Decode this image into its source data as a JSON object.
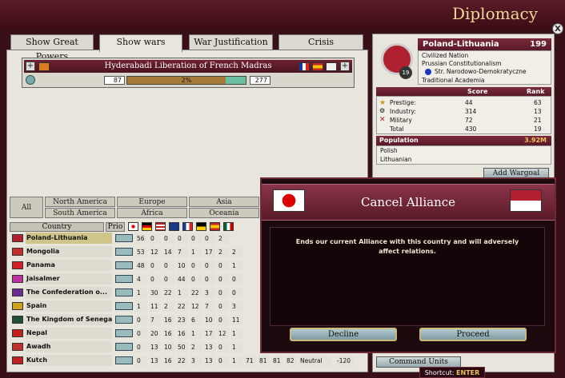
{
  "window": {
    "title": "Diplomacy",
    "close": "X"
  },
  "tabs": [
    {
      "label": "Show Great Powers"
    },
    {
      "label": "Show wars"
    },
    {
      "label": "War Justification"
    },
    {
      "label": "Crisis"
    }
  ],
  "war": {
    "name": "Hyderabadi Liberation of French Madras",
    "attacker_strength": "87",
    "score": "2%",
    "defender_strength": "277",
    "add": "+",
    "score_fraction": 0.02
  },
  "regions": {
    "all": "All",
    "north_america": "North America",
    "south_america": "South America",
    "europe": "Europe",
    "africa": "Africa",
    "asia": "Asia",
    "oceania": "Oceania"
  },
  "table": {
    "country_header": "Country",
    "prio_header": "Prio",
    "rows": [
      {
        "name": "Poland-Lithuania",
        "values": [
          "56",
          "0",
          "0",
          "0",
          "0",
          "0",
          "2"
        ],
        "selected": true
      },
      {
        "name": "Mongolia",
        "values": [
          "53",
          "12",
          "14",
          "7",
          "1",
          "17",
          "2",
          "2"
        ]
      },
      {
        "name": "Panama",
        "values": [
          "48",
          "0",
          "0",
          "10",
          "0",
          "0",
          "0",
          "1"
        ]
      },
      {
        "name": "Jaisalmer",
        "values": [
          "4",
          "0",
          "0",
          "44",
          "0",
          "0",
          "0",
          "0"
        ]
      },
      {
        "name": "The Confederation o...",
        "values": [
          "1",
          "30",
          "22",
          "1",
          "22",
          "3",
          "0",
          "0"
        ]
      },
      {
        "name": "Spain",
        "values": [
          "1",
          "11",
          "2",
          "22",
          "12",
          "7",
          "0",
          "3"
        ]
      },
      {
        "name": "The Kingdom of Senegal",
        "values": [
          "0",
          "7",
          "16",
          "23",
          "6",
          "10",
          "0",
          "11"
        ]
      },
      {
        "name": "Nepal",
        "values": [
          "0",
          "20",
          "16",
          "16",
          "1",
          "17",
          "12",
          "1"
        ]
      },
      {
        "name": "Awadh",
        "values": [
          "0",
          "13",
          "10",
          "50",
          "2",
          "13",
          "0",
          "1"
        ]
      },
      {
        "name": "Kutch",
        "values": [
          "0",
          "13",
          "16",
          "22",
          "3",
          "13",
          "0",
          "1",
          "71",
          "81",
          "81",
          "82",
          "Neutral",
          "-120"
        ]
      }
    ]
  },
  "country": {
    "name": "Poland-Lithuania",
    "number": "199",
    "rank_badge": "19",
    "lines": [
      "Civilized Nation",
      "Prussian Constitutionalism",
      "Str. Narodowo-Demokratyczne",
      "Traditional Academia"
    ],
    "score_header": "Score",
    "rank_header": "Rank",
    "stats": [
      {
        "label": "Prestige:",
        "score": "44",
        "rank": "63"
      },
      {
        "label": "Industry:",
        "score": "314",
        "rank": "13"
      },
      {
        "label": "Military",
        "score": "72",
        "rank": "21"
      },
      {
        "label": "Total",
        "score": "430",
        "rank": "19"
      }
    ],
    "population_label": "Population",
    "population_value": "3.92M",
    "cultures": [
      "Polish",
      "Lithuanian"
    ],
    "add_wargoal": "Add Wargoal",
    "command_units": "Command Units"
  },
  "modal": {
    "title": "Cancel Alliance",
    "text": "Ends our current Alliance with this country and will adversely affect relations.",
    "decline": "Decline",
    "proceed": "Proceed"
  },
  "shortcut": {
    "label": "Shortcut:",
    "key": "ENTER"
  },
  "colors": {
    "frame": "#3a1018",
    "modal_header": "#8a3448",
    "title_gold": "#f0d89a",
    "button_teal": "#9bb7bf"
  }
}
